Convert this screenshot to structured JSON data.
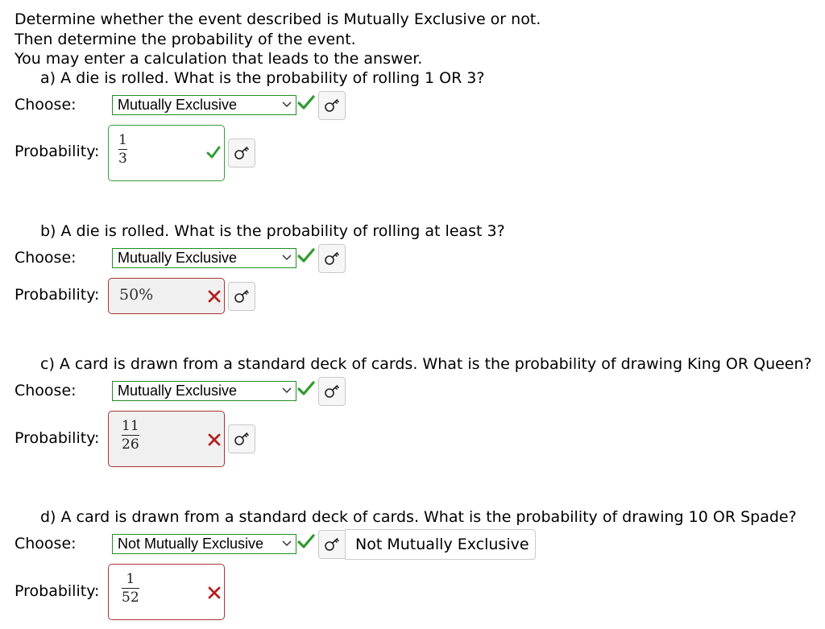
{
  "intro": [
    "Determine whether the event described is Mutually Exclusive or not.",
    "Then determine the probability of the event.",
    "You may enter a calculation that leads to the answer."
  ],
  "labels": {
    "choose": "Choose:",
    "probability": "Probability:"
  },
  "questions": [
    {
      "text": "a) A die is rolled. What is the probability of rolling 1 OR 3?",
      "selected": "Mutually Exclusive",
      "select_status": "correct",
      "answer": {
        "numerator": "1",
        "denominator": "3"
      },
      "answer_status": "correct"
    },
    {
      "text": "b) A die is rolled. What is the probability of rolling at least 3?",
      "selected": "Mutually Exclusive",
      "select_status": "correct",
      "answer": {
        "percent": "50%"
      },
      "answer_status": "incorrect"
    },
    {
      "text": "c) A card is drawn from a standard deck of cards. What is the probability of drawing King OR Queen?",
      "selected": "Mutually Exclusive",
      "select_status": "correct",
      "answer": {
        "numerator": "11",
        "denominator": "26"
      },
      "answer_status": "incorrect"
    },
    {
      "text": "d) A card is drawn from a standard deck of cards. What is the probability of drawing 10 OR Spade?",
      "selected": "Not Mutually Exclusive",
      "select_status": "correct",
      "revealed_answer": "Not Mutually Exclusive",
      "answer": {
        "numerator": "1",
        "denominator": "52"
      },
      "answer_status": "incorrect"
    }
  ],
  "colors": {
    "correct": "#2e9a2e",
    "incorrect": "#b22222",
    "select_border": "#1f8f1f"
  },
  "icons": {
    "check": "checkmark-icon",
    "cross": "cross-icon",
    "key": "key-icon",
    "arrow": "chevron-down-icon"
  }
}
